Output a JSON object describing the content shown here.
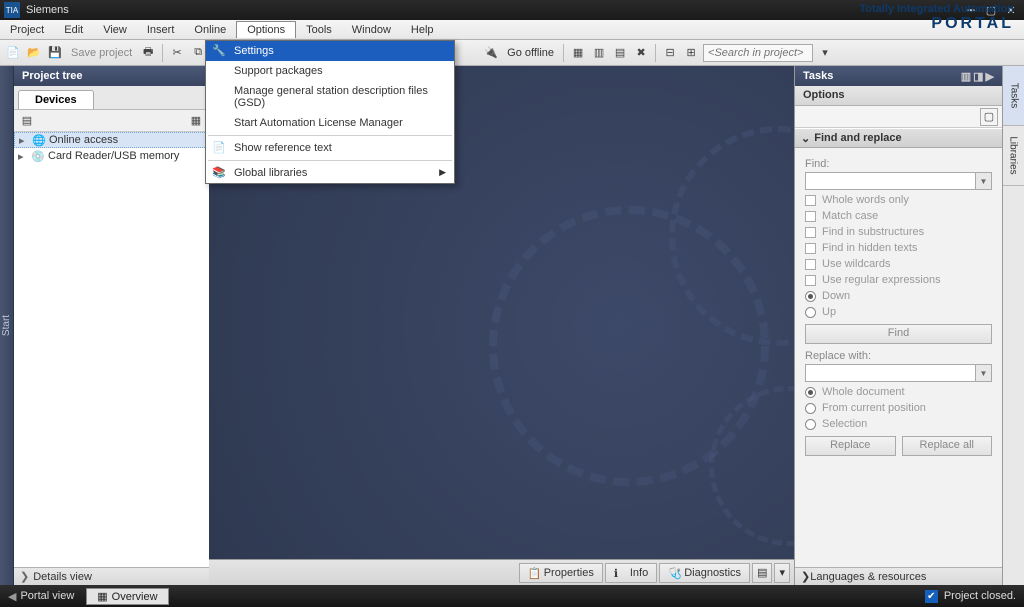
{
  "window": {
    "title": "Siemens"
  },
  "menubar": [
    "Project",
    "Edit",
    "View",
    "Insert",
    "Online",
    "Options",
    "Tools",
    "Window",
    "Help"
  ],
  "active_menu_index": 5,
  "toolbar": {
    "save_label": "Save project",
    "go_offline_label": "Go offline",
    "search_placeholder": "<Search in project>"
  },
  "brand": {
    "line1": "Totally Integrated Automation",
    "line2": "PORTAL"
  },
  "dropdown": {
    "items": [
      {
        "label": "Settings",
        "hl": true,
        "icon": "spanner"
      },
      {
        "label": "Support packages"
      },
      {
        "label": "Manage general station description files (GSD)"
      },
      {
        "label": "Start Automation License Manager"
      },
      {
        "sep": true
      },
      {
        "label": "Show reference text",
        "icon": "doc"
      },
      {
        "sep": true
      },
      {
        "label": "Global libraries",
        "icon": "book",
        "submenu": true
      }
    ]
  },
  "project_tree": {
    "title": "Project tree",
    "tab": "Devices",
    "items": [
      {
        "label": "Online access",
        "icon": "globe"
      },
      {
        "label": "Card Reader/USB memory",
        "icon": "usb"
      }
    ],
    "footer": "Details view"
  },
  "left_strip": "Start",
  "canvas_tabs": {
    "properties": "Properties",
    "info": "Info",
    "diagnostics": "Diagnostics"
  },
  "tasks_panel": {
    "title": "Tasks",
    "options_label": "Options",
    "find_replace": {
      "header": "Find and replace",
      "find_label": "Find:",
      "checks": [
        "Whole words only",
        "Match case",
        "Find in substructures",
        "Find in hidden texts",
        "Use wildcards",
        "Use regular expressions"
      ],
      "direction": {
        "down": "Down",
        "up": "Up",
        "selected": "down"
      },
      "find_btn": "Find",
      "replace_label": "Replace with:",
      "scope": {
        "options": [
          "Whole document",
          "From current position",
          "Selection"
        ],
        "selected": 0
      },
      "replace_btn": "Replace",
      "replace_all_btn": "Replace all"
    },
    "footer": "Languages & resources"
  },
  "side_tabs": [
    "Tasks",
    "Libraries"
  ],
  "statusbar": {
    "portal_view": "Portal view",
    "overview": "Overview",
    "status": "Project closed."
  }
}
